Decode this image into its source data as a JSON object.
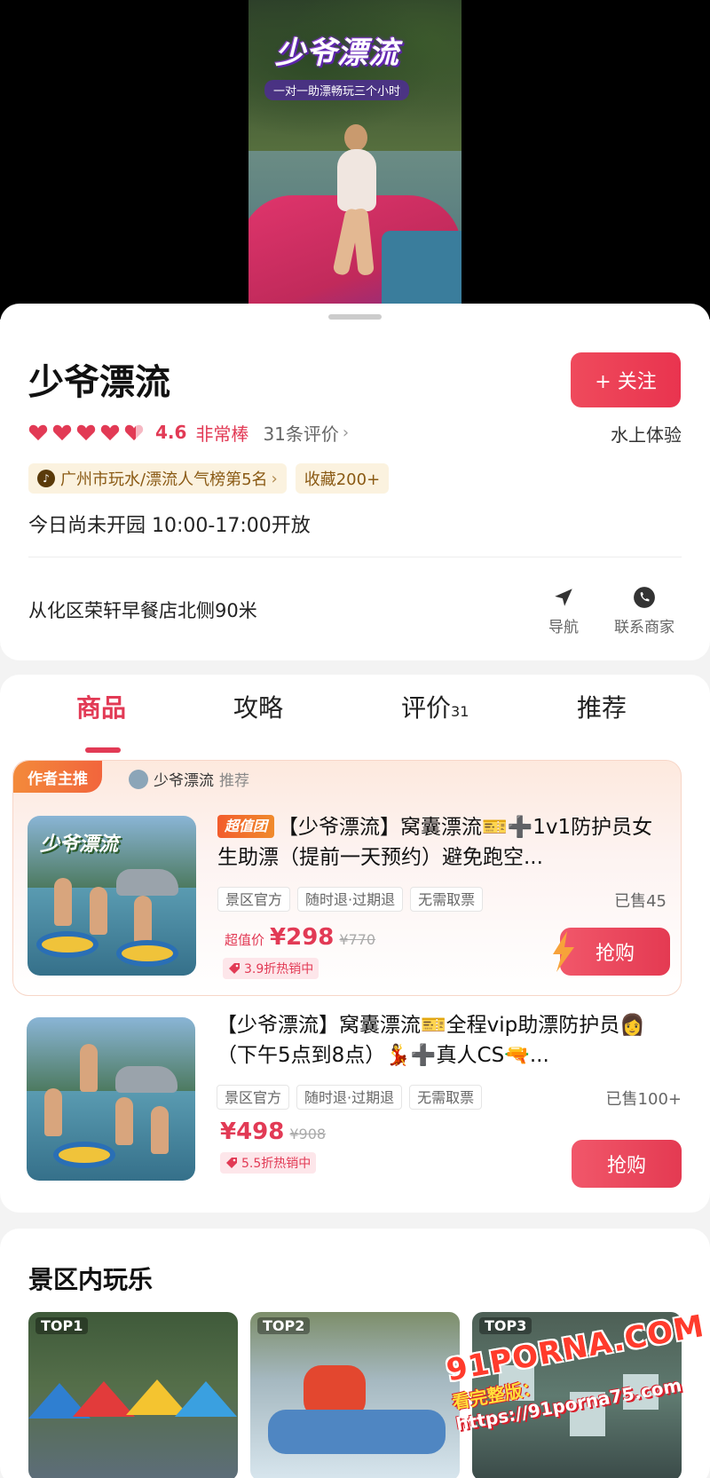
{
  "video": {
    "title": "少爷漂流",
    "subtitle": "一对一助漂畅玩三个小时"
  },
  "place": {
    "name": "少爷漂流",
    "follow_label": "+ 关注",
    "hearts": 5,
    "score": "4.6",
    "score_word": "非常棒",
    "review_count": "31条评价",
    "category": "水上体验",
    "rank_badge": "广州市玩水/漂流人气榜第5名",
    "fav_badge": "收藏200+",
    "hours": "今日尚未开园 10:00-17:00开放",
    "address": "从化区荣轩早餐店北侧90米",
    "nav_label": "导航",
    "contact_label": "联系商家"
  },
  "tabs": [
    {
      "label": "商品",
      "count": ""
    },
    {
      "label": "攻略",
      "count": ""
    },
    {
      "label": "评价",
      "count": "31"
    },
    {
      "label": "推荐",
      "count": ""
    }
  ],
  "featured": {
    "author_pick": "作者主推",
    "shop": "少爷漂流",
    "recommend": "推荐"
  },
  "products": [
    {
      "thumb_title": "少爷漂流",
      "super_tag": "超值团",
      "title": "【少爷漂流】窝囊漂流🎫➕1v1防护员女生助漂（提前一天预约）避免跑空...",
      "tags": [
        "景区官方",
        "随时退·过期退",
        "无需取票"
      ],
      "sold": "已售45",
      "price_label": "超值价",
      "price": "¥298",
      "orig_price": "¥770",
      "discount": "3.9折热销中",
      "buy_label": "抢购"
    },
    {
      "thumb_title": "",
      "super_tag": "",
      "title": "【少爷漂流】窝囊漂流🎫全程vip助漂防护员👩（下午5点到8点）💃➕真人CS🔫...",
      "tags": [
        "景区官方",
        "随时退·过期退",
        "无需取票"
      ],
      "sold": "已售100+",
      "price_label": "",
      "price": "¥498",
      "orig_price": "¥908",
      "discount": "5.5折热销中",
      "buy_label": "抢购"
    }
  ],
  "play": {
    "title": "景区内玩乐",
    "tiles": [
      "TOP1",
      "TOP2",
      "TOP3"
    ]
  },
  "watermark": {
    "logo": "91PORNA.COM",
    "prefix": "看完整版：",
    "url": "https://91porna75.com"
  },
  "colors": {
    "accent": "#e23a55",
    "pick": "#f2653c"
  }
}
